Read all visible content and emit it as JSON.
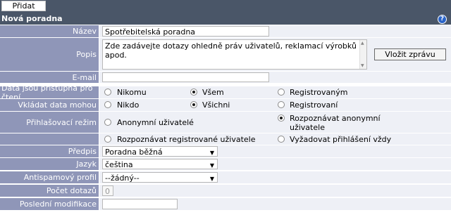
{
  "toolbar": {
    "add_label": "Přidat"
  },
  "panel": {
    "title": "Nová poradna",
    "help_glyph": "?"
  },
  "form": {
    "name": {
      "label": "Název",
      "value": "Spotřebitelská poradna"
    },
    "description": {
      "label": "Popis",
      "value": "Zde zadávejte dotazy ohledně práv uživatelů, reklamací výrobků apod.",
      "insert_button": "Vložit zprávu"
    },
    "email": {
      "label": "E-mail",
      "value": ""
    },
    "read_access": {
      "label": "Data jsou přístupná pro čtení",
      "options": [
        "Nikomu",
        "Všem",
        "Registrovaným"
      ],
      "selected": "Všem"
    },
    "write_access": {
      "label": "Vkládat data mohou",
      "options": [
        "Nikdo",
        "Všichni",
        "Registrovaní"
      ],
      "selected": "Všichni"
    },
    "login_mode": {
      "label": "Přihlašovací režim",
      "options": [
        "Anonymní uživatelé",
        "Rozpoznávat anonymní uživatele",
        "Rozpoznávat registrované uživatele",
        "Vyžadovat přihlášení vždy"
      ],
      "selected": "Rozpoznávat anonymní uživatele"
    },
    "template": {
      "label": "Předpis",
      "value": "Poradna běžná"
    },
    "language": {
      "label": "Jazyk",
      "value": "čeština"
    },
    "antispam": {
      "label": "Antispamový profil",
      "value": "--žádný--"
    },
    "question_count": {
      "label": "Počet dotazů",
      "value": "0"
    },
    "last_modified": {
      "label": "Poslední modifikace",
      "value": ""
    }
  },
  "colors": {
    "header": "#4a5668",
    "label_bg": "#8f96b8",
    "field_bg": "#eef0f6"
  }
}
